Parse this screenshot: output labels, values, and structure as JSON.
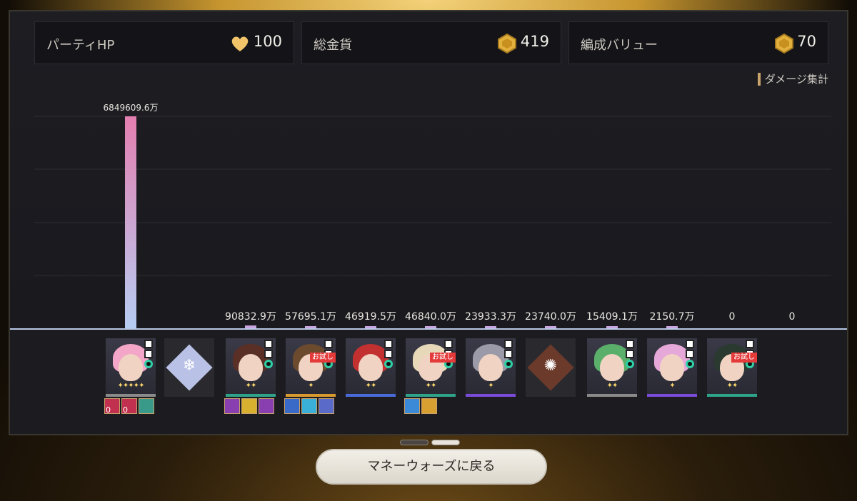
{
  "stats": [
    {
      "label": "パーティHP",
      "value": "100",
      "icon": "heart-icon",
      "color": "#f1c46a"
    },
    {
      "label": "総金貨",
      "value": "419",
      "icon": "gold-coin-icon",
      "color": "#e2b13d"
    },
    {
      "label": "編成バリュー",
      "value": "70",
      "icon": "gold-coin-icon",
      "color": "#e2b13d"
    }
  ],
  "legend": {
    "label": "ダメージ集計"
  },
  "chart_data": {
    "type": "bar",
    "categories": [
      "slot1",
      "slot2",
      "slot3",
      "slot4",
      "slot5",
      "slot6",
      "slot7",
      "slot8",
      "slot9",
      "slot10",
      "slot11",
      "slot12"
    ],
    "values": [
      6849609.6,
      0,
      90832.9,
      57695.1,
      46919.5,
      46840.0,
      23933.3,
      23740.0,
      15409.1,
      2150.7,
      0,
      0
    ],
    "labels": [
      "6849609.6万",
      "",
      "90832.9万",
      "57695.1万",
      "46919.5万",
      "46840.0万",
      "23933.3万",
      "23740.0万",
      "15409.1万",
      "2150.7万",
      "0",
      "0"
    ],
    "ylim": [
      0,
      6849609.6
    ],
    "grid": true
  },
  "characters": [
    {
      "kind": "char",
      "hair": "#f4a6c8",
      "bar": "#8a8a8a",
      "stars": "✦✦✦✦✦",
      "trial": false,
      "relics": [
        "#c23050",
        "#c23050",
        "#3a9a8a"
      ],
      "relic_counts": [
        "0",
        "0",
        ""
      ]
    },
    {
      "kind": "element",
      "icon": "ice-element-icon",
      "diamond": "#b9c2e6",
      "glyph": "❄"
    },
    {
      "kind": "char",
      "hair": "#5a2f25",
      "bar": "#2fa28a",
      "stars": "✦✦",
      "trial": false,
      "relics": [
        "#8a3fb0",
        "#d8b030",
        "#8a3fb0"
      ],
      "relic_counts": [
        "",
        "",
        ""
      ]
    },
    {
      "kind": "char",
      "hair": "#6b4a2e",
      "bar": "#d89a2e",
      "stars": "✦",
      "trial": true,
      "relics": [
        "#3a6ac8",
        "#3ab0d8",
        "#5a6ac8"
      ],
      "relic_counts": [
        "",
        "",
        ""
      ]
    },
    {
      "kind": "char",
      "hair": "#c23030",
      "bar": "#4a6ad8",
      "stars": "✦✦",
      "trial": false,
      "relics": [],
      "relic_counts": []
    },
    {
      "kind": "char",
      "hair": "#e6d8b8",
      "bar": "#2fa28a",
      "stars": "✦✦",
      "trial": true,
      "relics": [
        "#3a8ad8",
        "#d8a030"
      ],
      "relic_counts": [
        "",
        ""
      ]
    },
    {
      "kind": "char",
      "hair": "#9a9aa8",
      "bar": "#7a4ad8",
      "stars": "✦",
      "trial": false,
      "relics": [],
      "relic_counts": []
    },
    {
      "kind": "element",
      "icon": "fire-element-icon",
      "diamond": "#6b3a2a",
      "glyph": "✺"
    },
    {
      "kind": "char",
      "hair": "#5ab06a",
      "bar": "#8a8a8a",
      "stars": "✦✦",
      "trial": false,
      "relics": [],
      "relic_counts": []
    },
    {
      "kind": "char",
      "hair": "#e6a8d8",
      "bar": "#7a4ad8",
      "stars": "✦",
      "trial": false,
      "relics": [],
      "relic_counts": []
    },
    {
      "kind": "char",
      "hair": "#2a3a30",
      "bar": "#2fa28a",
      "stars": "✦✦",
      "trial": true,
      "relics": [],
      "relic_counts": []
    }
  ],
  "trial_label": "お試し",
  "pager": {
    "active": 1,
    "count": 2
  },
  "back_button": {
    "label": "マネーウォーズに戻る"
  }
}
